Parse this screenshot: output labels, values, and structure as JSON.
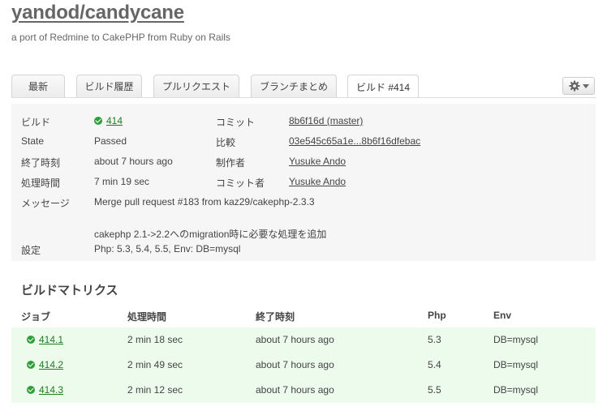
{
  "repo": {
    "title": "yandod/candycane",
    "description": "a port of Redmine to CakePHP from Ruby on Rails"
  },
  "tabs": [
    {
      "label": "最新"
    },
    {
      "label": "ビルド履歴"
    },
    {
      "label": "プルリクエスト"
    },
    {
      "label": "ブランチまとめ"
    },
    {
      "label": "ビルド #414"
    }
  ],
  "settings_icon": "gear-icon",
  "summary": {
    "build_label": "ビルド",
    "build_value": "414",
    "commit_label": "コミット",
    "commit_value": "8b6f16d (master)",
    "state_label": "State",
    "state_value": "Passed",
    "compare_label": "比較",
    "compare_value": "03e545c65a1e...8b6f16dfebac",
    "finished_label": "終了時刻",
    "finished_value": "about 7 hours ago",
    "author_label": "制作者",
    "author_value": "Yusuke Ando",
    "duration_label": "処理時間",
    "duration_value": "7 min 19 sec",
    "committer_label": "コミット者",
    "committer_value": "Yusuke Ando",
    "message_label": "メッセージ",
    "message_line1": "Merge pull request #183 from kaz29/cakephp-2.3.3",
    "message_line2": "cakephp 2.1->2.2へのmigration時に必要な処理を追加",
    "config_label": "設定",
    "config_value": "Php: 5.3, 5.4, 5.5, Env: DB=mysql"
  },
  "matrix": {
    "title": "ビルドマトリクス",
    "headers": {
      "job": "ジョブ",
      "duration": "処理時間",
      "finished": "終了時刻",
      "php": "Php",
      "env": "Env"
    },
    "rows": [
      {
        "job": "414.1",
        "duration": "2 min 18 sec",
        "finished": "about 7 hours ago",
        "php": "5.3",
        "env": "DB=mysql"
      },
      {
        "job": "414.2",
        "duration": "2 min 49 sec",
        "finished": "about 7 hours ago",
        "php": "5.4",
        "env": "DB=mysql"
      },
      {
        "job": "414.3",
        "duration": "2 min 12 sec",
        "finished": "about 7 hours ago",
        "php": "5.5",
        "env": "DB=mysql"
      }
    ]
  },
  "colors": {
    "success": "#2e9e3a",
    "matrix_row_bg": "#edfbec",
    "summary_bg": "#f6f6f6"
  }
}
